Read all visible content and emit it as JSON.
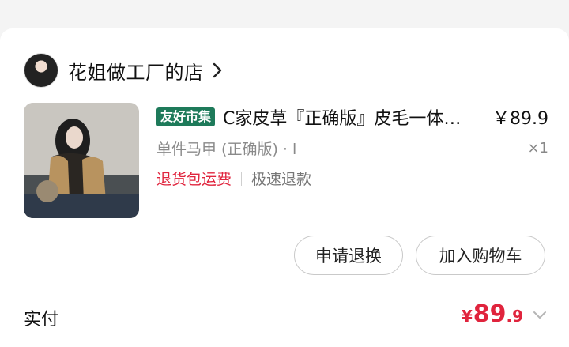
{
  "shop": {
    "name": "花姐做工厂的店",
    "avatar_icon": "shop-avatar",
    "chevron_icon": "chevron-right-icon"
  },
  "product": {
    "tag": "友好市集",
    "title": "C家皮草『正确版』皮毛一体马甲",
    "price": "￥89.9",
    "spec": "单件马甲 (正确版) · l",
    "quantity": "×1",
    "service_return": "退货包运费",
    "service_refund": "极速退款"
  },
  "actions": {
    "refund_label": "申请退换",
    "cart_label": "加入购物车"
  },
  "payment": {
    "label": "实付",
    "symbol": "¥",
    "amount_int": "89",
    "amount_dec": ".9",
    "expand_icon": "chevron-down-icon"
  },
  "colors": {
    "accent_red": "#e0243d",
    "tag_green": "#1e7a5a"
  }
}
